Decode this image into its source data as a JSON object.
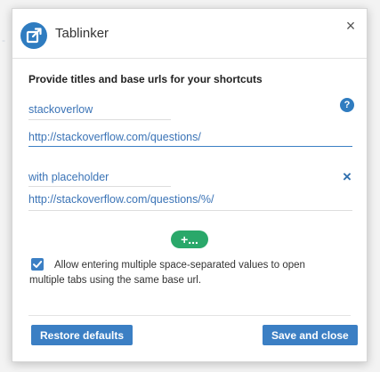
{
  "app": {
    "title": "Tablinker",
    "close_glyph": "×"
  },
  "section": {
    "title": "Provide titles and base urls for your shortcuts"
  },
  "shortcuts": [
    {
      "title": "stackoverlow",
      "url": "http://stackoverflow.com/questions/"
    },
    {
      "title": "with placeholder",
      "url": "http://stackoverflow.com/questions/%/"
    }
  ],
  "icons": {
    "help": "?",
    "remove": "×",
    "add": "+..."
  },
  "option": {
    "checked": true,
    "label": "Allow entering multiple space-separated values to open multiple tabs using the same base url."
  },
  "buttons": {
    "restore": "Restore defaults",
    "save": "Save and close"
  },
  "colors": {
    "accent": "#3b7fc4",
    "add_button": "#2aa86a",
    "link_text": "#3a73b6"
  }
}
